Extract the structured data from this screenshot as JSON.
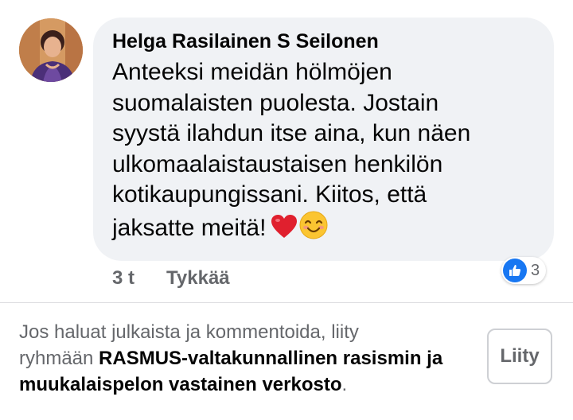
{
  "comment": {
    "author": "Helga Rasilainen S Seilonen",
    "text_lines": [
      "Anteeksi meidän hölmöjen",
      "suomalaisten puolesta. Jostain",
      "syystä ilahdun itse aina, kun näen",
      "ulkomaalaistaustaisen henkilön",
      "kotikaupungissani. Kiitos, että",
      "jaksatte meitä!"
    ],
    "emojis": [
      "heart-emoji",
      "smiling-face-emoji"
    ],
    "timestamp": "3 t",
    "like_action": "Tykkää",
    "reaction_count": "3",
    "reaction_icon": "thumbs-up-icon",
    "reaction_color": "#1877f2"
  },
  "join_prompt": {
    "text_line_1": "Jos haluat julkaista ja kommentoida, liity",
    "text_line_2_prefix": "ryhmään ",
    "group_name_part_1": "RASMUS-valtakunnallinen rasismin ja",
    "group_name_part_2": "muukalaispelon vastainen verkosto",
    "text_suffix": ".",
    "join_button": "Liity"
  },
  "colors": {
    "bubble_background": "#f0f2f5",
    "secondary_text": "#65676b",
    "primary_text": "#050505",
    "divider": "#dcdde0"
  }
}
